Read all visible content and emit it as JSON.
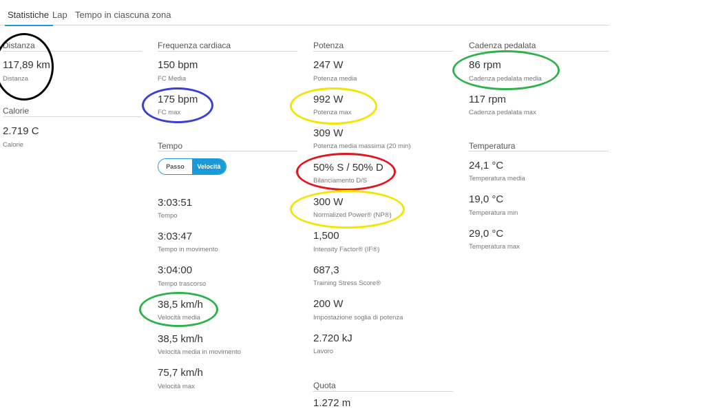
{
  "tabs": [
    {
      "label": "Statistiche"
    },
    {
      "label": "Lap"
    },
    {
      "label": "Tempo in ciascuna zona"
    }
  ],
  "distanza": {
    "title": "Distanza",
    "stats": [
      {
        "value": "117,89 km",
        "label": "Distanza"
      }
    ]
  },
  "calorie": {
    "title": "Calorie",
    "stats": [
      {
        "value": "2.719 C",
        "label": "Calorie"
      }
    ]
  },
  "frequenza": {
    "title": "Frequenza cardiaca",
    "stats": [
      {
        "value": "150 bpm",
        "label": "FC Media"
      },
      {
        "value": "175 bpm",
        "label": "FC max"
      }
    ]
  },
  "tempo": {
    "title": "Tempo",
    "toggle": {
      "option_passo": "Passo",
      "option_velocita": "Velocità"
    },
    "stats": [
      {
        "value": "3:03:51",
        "label": "Tempo"
      },
      {
        "value": "3:03:47",
        "label": "Tempo in movimento"
      },
      {
        "value": "3:04:00",
        "label": "Tempo trascorso"
      },
      {
        "value": "38,5 km/h",
        "label": "Velocità media"
      },
      {
        "value": "38,5 km/h",
        "label": "Velocità media in movimento"
      },
      {
        "value": "75,7 km/h",
        "label": "Velocità max"
      }
    ]
  },
  "potenza": {
    "title": "Potenza",
    "stats": [
      {
        "value": "247 W",
        "label": "Potenza media"
      },
      {
        "value": "992 W",
        "label": "Potenza max"
      },
      {
        "value": "309 W",
        "label": "Potenza media massima (20 min)"
      },
      {
        "value": "50% S / 50% D",
        "label": "Bilanciamento D/S"
      },
      {
        "value": "300 W",
        "label": "Normalized Power® (NP®)"
      },
      {
        "value": "1,500",
        "label": "Intensity Factor® (IF®)"
      },
      {
        "value": "687,3",
        "label": "Training Stress Score®"
      },
      {
        "value": "200 W",
        "label": "Impostazione soglia di potenza"
      },
      {
        "value": "2.720 kJ",
        "label": "Lavoro"
      }
    ]
  },
  "quota": {
    "title": "Quota",
    "stats": [
      {
        "value": "1.272 m"
      }
    ]
  },
  "cadenza": {
    "title": "Cadenza pedalata",
    "stats": [
      {
        "value": "86 rpm",
        "label": "Cadenza pedalata media"
      },
      {
        "value": "117 rpm",
        "label": "Cadenza pedalata max"
      }
    ]
  },
  "temperatura": {
    "title": "Temperatura",
    "stats": [
      {
        "value": "24,1 °C",
        "label": "Temperatura media"
      },
      {
        "value": "19,0 °C",
        "label": "Temperatura min"
      },
      {
        "value": "29,0 °C",
        "label": "Temperatura max"
      }
    ]
  },
  "annotation_colors": {
    "black": "#000000",
    "blue": "#3a3fd0",
    "yellow": "#f2e600",
    "red": "#e3141b",
    "green": "#2fb24a"
  },
  "accent_color": "#1a9bd7"
}
